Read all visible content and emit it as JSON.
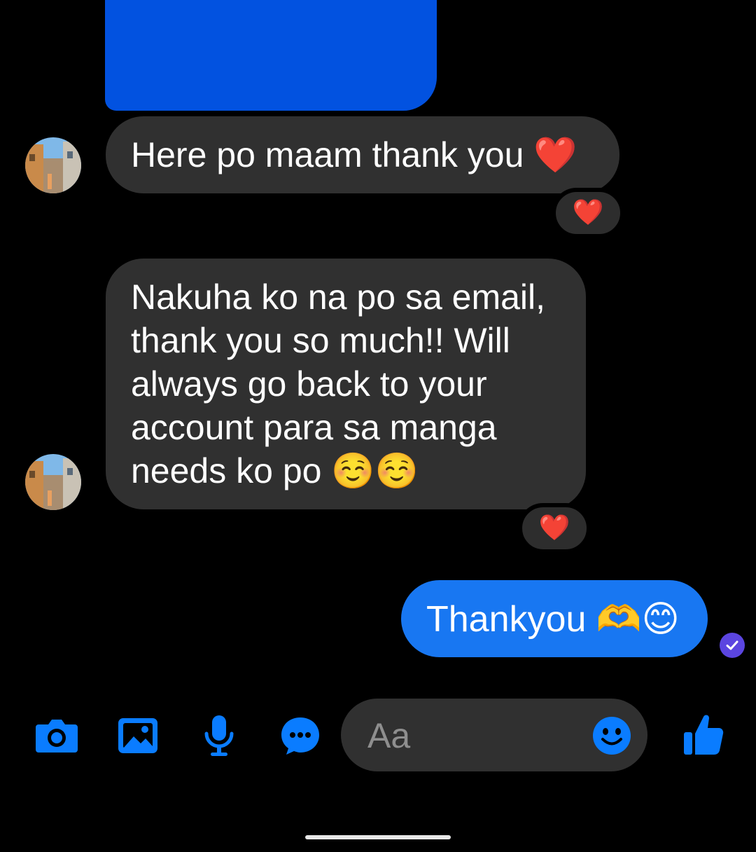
{
  "messages": [
    {
      "sender": "them",
      "text": "Here po maam thank you ❤️",
      "reaction": "❤️"
    },
    {
      "sender": "them",
      "lines": [
        "Nakuha ko na po sa email,",
        "thank you so much!! Will",
        "always go back to your",
        "account para sa manga",
        "needs ko po ☺️☺️"
      ],
      "reaction": "❤️"
    },
    {
      "sender": "me",
      "text": "Thankyou 🫶😊"
    }
  ],
  "composer": {
    "placeholder": "Aa",
    "toolbar_icons": [
      "camera-icon",
      "gallery-icon",
      "microphone-icon",
      "chat-more-icon"
    ],
    "emoji_icon": "smiley-icon",
    "send_icon": "thumbs-up-icon"
  },
  "colors": {
    "background": "#000000",
    "incoming_bubble": "#303030",
    "outgoing_bubble": "#1877f2",
    "accent": "#0a7cff",
    "seen_badge": "#5b45e0"
  }
}
